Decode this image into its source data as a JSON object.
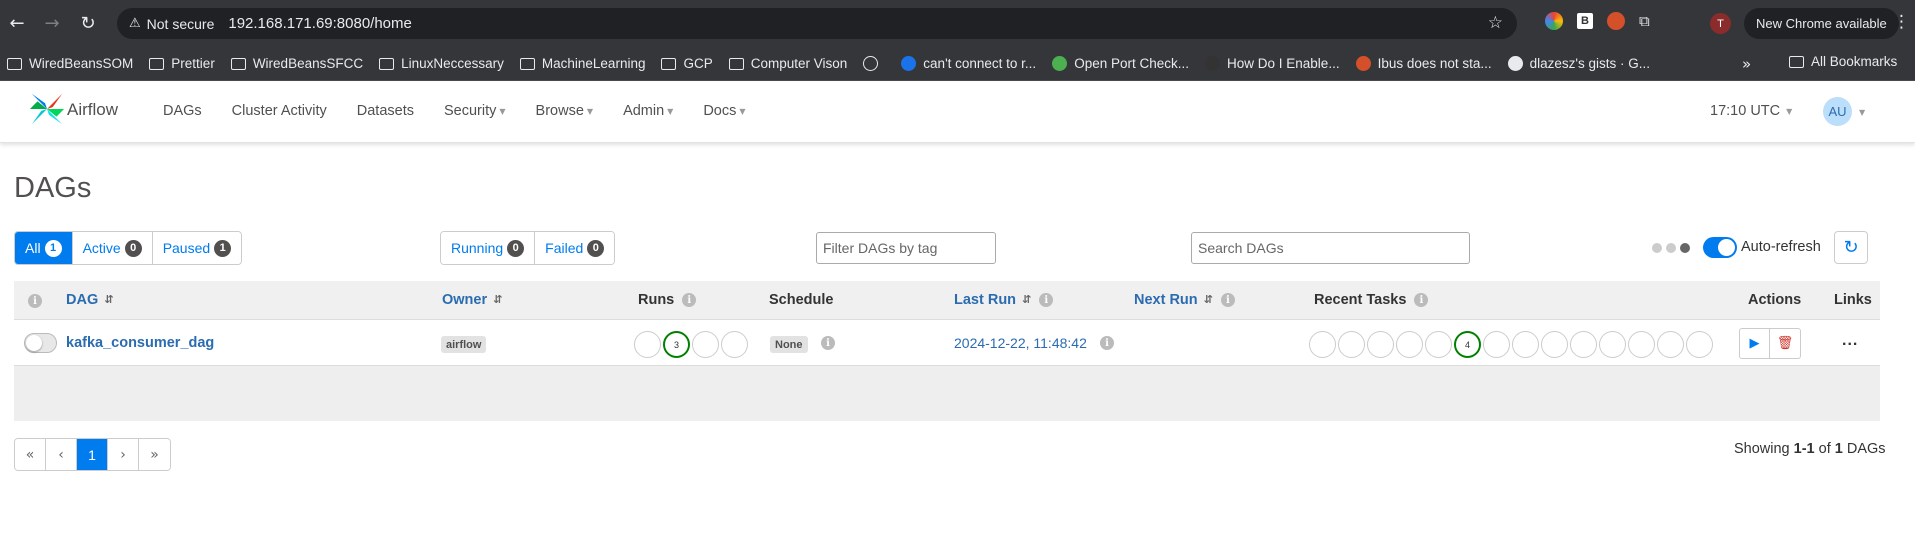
{
  "browser": {
    "not_secure_label": "Not secure",
    "url": "192.168.171.69:8080/home",
    "profile_initial": "T",
    "new_chrome_label": "New Chrome available",
    "bookmarks": [
      {
        "label": "WiredBeansSOM",
        "type": "folder"
      },
      {
        "label": "Prettier",
        "type": "folder"
      },
      {
        "label": "WiredBeansSFCC",
        "type": "folder"
      },
      {
        "label": "LinuxNeccessary",
        "type": "folder"
      },
      {
        "label": "MachineLearning",
        "type": "folder"
      },
      {
        "label": "GCP",
        "type": "folder"
      },
      {
        "label": "Computer Vison",
        "type": "folder"
      },
      {
        "label": "",
        "type": "globe"
      },
      {
        "label": "can't connect to r...",
        "type": "site"
      },
      {
        "label": "Open Port Check...",
        "type": "site"
      },
      {
        "label": "How Do I Enable...",
        "type": "site"
      },
      {
        "label": "Ibus does not sta...",
        "type": "site"
      },
      {
        "label": "dlazesz's gists · G...",
        "type": "site"
      }
    ],
    "all_bookmarks_label": "All Bookmarks"
  },
  "navbar": {
    "brand": "Airflow",
    "menu": [
      {
        "label": "DAGs",
        "dropdown": false
      },
      {
        "label": "Cluster Activity",
        "dropdown": false
      },
      {
        "label": "Datasets",
        "dropdown": false
      },
      {
        "label": "Security",
        "dropdown": true
      },
      {
        "label": "Browse",
        "dropdown": true
      },
      {
        "label": "Admin",
        "dropdown": true
      },
      {
        "label": "Docs",
        "dropdown": true
      }
    ],
    "time": "17:10 UTC",
    "user_initials": "AU"
  },
  "page": {
    "title": "DAGs",
    "status_filters": {
      "all": {
        "label": "All",
        "count": "1"
      },
      "active": {
        "label": "Active",
        "count": "0"
      },
      "paused": {
        "label": "Paused",
        "count": "1"
      }
    },
    "run_filters": {
      "running": {
        "label": "Running",
        "count": "0"
      },
      "failed": {
        "label": "Failed",
        "count": "0"
      }
    },
    "tag_filter_placeholder": "Filter DAGs by tag",
    "search_placeholder": "Search DAGs",
    "auto_refresh_label": "Auto-refresh"
  },
  "table": {
    "headers": {
      "dag": "DAG",
      "owner": "Owner",
      "runs": "Runs",
      "schedule": "Schedule",
      "last_run": "Last Run",
      "next_run": "Next Run",
      "recent_tasks": "Recent Tasks",
      "actions": "Actions",
      "links": "Links"
    },
    "rows": [
      {
        "dag_id": "kafka_consumer_dag",
        "owner": "airflow",
        "runs": [
          "",
          "3",
          "",
          ""
        ],
        "schedule": "None",
        "last_run": "2024-12-22, 11:48:42",
        "next_run": "",
        "recent_tasks": [
          "",
          "",
          "",
          "",
          "",
          "4",
          "",
          "",
          "",
          "",
          "",
          "",
          "",
          ""
        ],
        "links_label": "..."
      }
    ]
  },
  "pagination": {
    "first": "«",
    "prev": "‹",
    "current": "1",
    "next": "›",
    "last": "»"
  },
  "summary": {
    "prefix": "Showing",
    "range": "1-1",
    "of": "of",
    "total": "1",
    "suffix": "DAGs"
  },
  "colors": {
    "accent": "#017cee",
    "success": "#008000",
    "link": "#2b6cb0",
    "delete": "#d0342c"
  }
}
